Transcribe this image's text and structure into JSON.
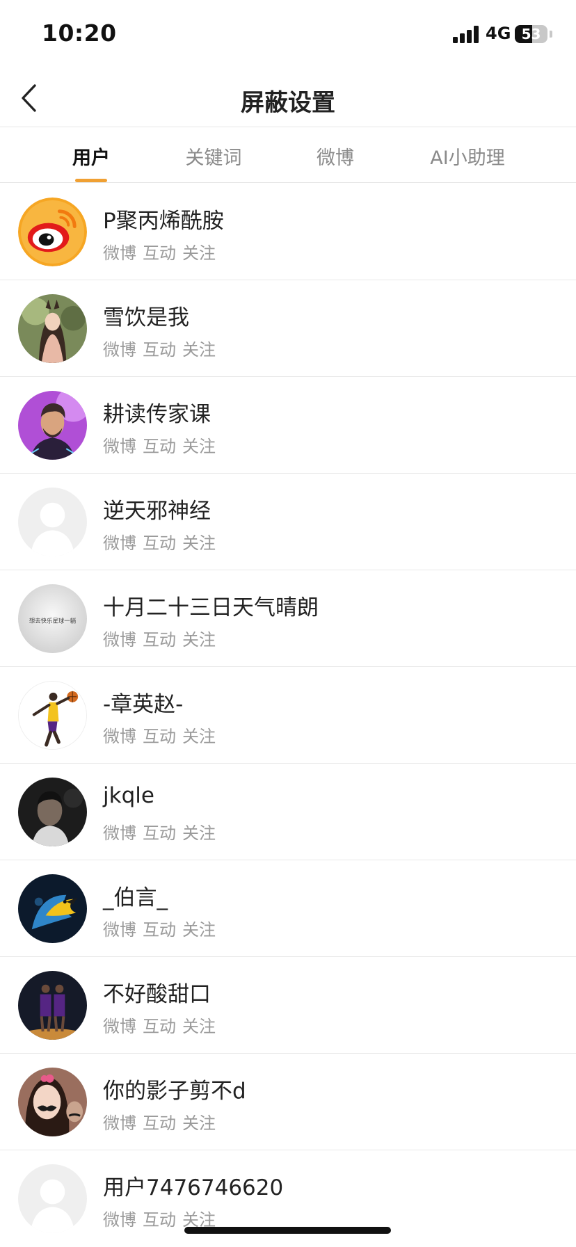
{
  "status": {
    "time": "10:20",
    "network": "4G",
    "battery": "53",
    "battery_level": 0.53
  },
  "header": {
    "title": "屏蔽设置"
  },
  "tabs": [
    {
      "label": "用户",
      "active": true
    },
    {
      "label": "关键词",
      "active": false
    },
    {
      "label": "微博",
      "active": false
    },
    {
      "label": "AI小助理",
      "active": false
    }
  ],
  "accent": "#f0a033",
  "users": [
    {
      "name": "P聚丙烯酰胺",
      "tags": [
        "微博",
        "互动",
        "关注"
      ],
      "avatar": "weibo-logo-avatar"
    },
    {
      "name": "雪饮是我",
      "tags": [
        "微博",
        "互动",
        "关注"
      ],
      "avatar": "anime-girl-avatar"
    },
    {
      "name": "耕读传家课",
      "tags": [
        "微博",
        "互动",
        "关注"
      ],
      "avatar": "bearded-man-avatar"
    },
    {
      "name": "逆天邪神经",
      "tags": [
        "微博",
        "互动",
        "关注"
      ],
      "avatar": "default-avatar"
    },
    {
      "name": "十月二十三日天气晴朗",
      "tags": [
        "微博",
        "互动",
        "关注"
      ],
      "avatar": "text-paper-avatar"
    },
    {
      "name": "-章英赵-",
      "tags": [
        "微博",
        "互动",
        "关注"
      ],
      "avatar": "basketball-player-avatar"
    },
    {
      "name": "jkqle",
      "tags": [
        "微博",
        "互动",
        "关注"
      ],
      "avatar": "dark-portrait-avatar"
    },
    {
      "name": "_伯言_",
      "tags": [
        "微博",
        "互动",
        "关注"
      ],
      "avatar": "parrot-avatar"
    },
    {
      "name": "不好酸甜口",
      "tags": [
        "微博",
        "互动",
        "关注"
      ],
      "avatar": "basketball-court-avatar"
    },
    {
      "name": "你的影子剪不d",
      "tags": [
        "微博",
        "互动",
        "关注"
      ],
      "avatar": "selfie-avatar"
    },
    {
      "name": "用户7476746620",
      "tags": [
        "微博",
        "互动",
        "关注"
      ],
      "avatar": "default-avatar"
    }
  ],
  "avatar_text": "想去快乐星球一躺"
}
